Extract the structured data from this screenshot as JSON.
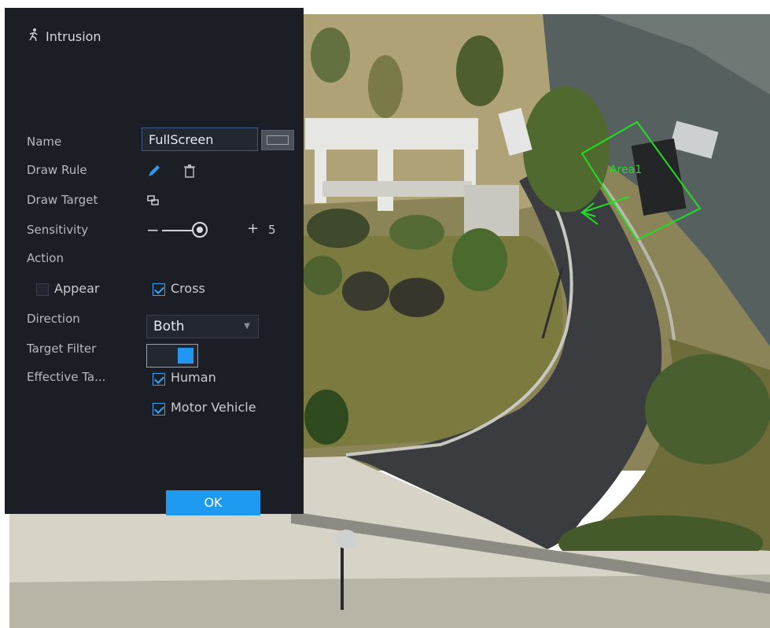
{
  "panel": {
    "title": "Intrusion",
    "title_icon": "running-person-icon",
    "name_label": "Name",
    "name_value": "FullScreen",
    "keyboard_icon": "keyboard-icon",
    "draw_rule_label": "Draw Rule",
    "draw_rule_icons": [
      "pencil-icon",
      "trash-icon"
    ],
    "draw_target_label": "Draw Target",
    "draw_target_icon": "draw-target-icon",
    "sensitivity_label": "Sensitivity",
    "sensitivity_minus": "−",
    "sensitivity_plus": "+",
    "sensitivity_value": "5",
    "action_label": "Action",
    "appear_label": "Appear",
    "appear_checked": false,
    "cross_label": "Cross",
    "cross_checked": true,
    "direction_label": "Direction",
    "direction_value": "Both",
    "target_filter_label": "Target Filter",
    "target_filter_on": true,
    "effective_target_label": "Effective Ta...",
    "human_label": "Human",
    "human_checked": true,
    "motor_vehicle_label": "Motor Vehicle",
    "motor_vehicle_checked": true,
    "ok_label": "OK"
  },
  "overlay": {
    "area_label": "Area1",
    "rule_color": "#22dd22"
  },
  "colors": {
    "panel_bg": "#1b1e24",
    "accent": "#1e9bf0"
  }
}
